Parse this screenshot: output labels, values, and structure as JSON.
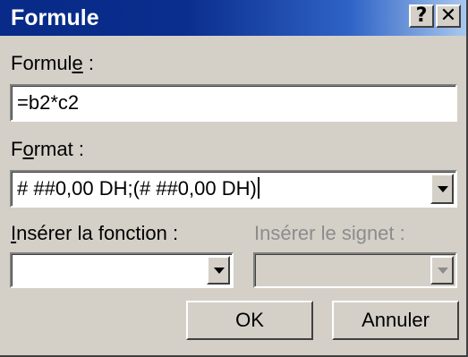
{
  "dialog": {
    "title": "Formule",
    "help_glyph": "?",
    "close_glyph": "✕"
  },
  "formula": {
    "label_before": "Formul",
    "label_accel": "e",
    "label_after": " :",
    "value": "=b2*c2"
  },
  "format": {
    "label_before": "F",
    "label_accel": "o",
    "label_after": "rmat :",
    "value": "# ##0,00 DH;(# ##0,00 DH)"
  },
  "insert_function": {
    "label_accel": "I",
    "label_after": "nsérer la fonction :",
    "value": ""
  },
  "insert_bookmark": {
    "label": "Insérer le signet :",
    "value": ""
  },
  "buttons": {
    "ok": "OK",
    "cancel": "Annuler"
  },
  "icons": {
    "help": "question-mark-icon",
    "close": "close-icon",
    "dropdown": "chevron-down-icon"
  }
}
